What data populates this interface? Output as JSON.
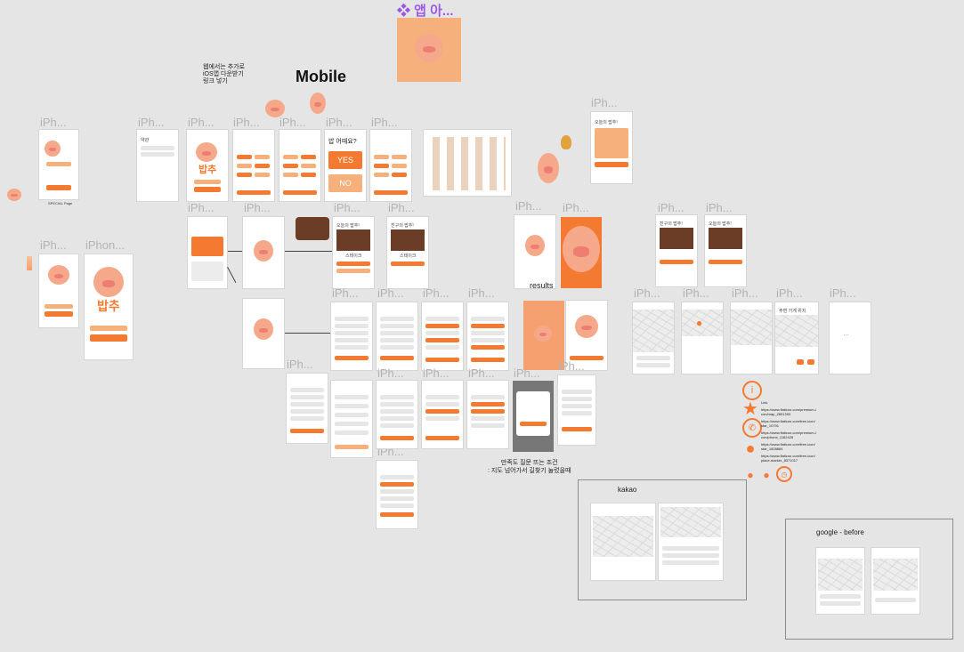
{
  "header": {
    "component_title": "❖ 앱 아...",
    "mobile": "Mobile",
    "note_ios": "웹에서는 추가로\niOS앱 다운받기\n링크 넣기"
  },
  "labels": {
    "iph": "iPh...",
    "iphon": "iPhon...",
    "results": "results",
    "kakao": "kakao",
    "google_before": "google - before",
    "survey_note": "만족도 질문 뜨는 조건\n: 지도 넘어가서 길찾기 눌렀을때",
    "special_page": "SPECIAL Page"
  },
  "screens": {
    "yes": "YES",
    "no": "NO",
    "question": "밥 어때요?",
    "todays_menu": "오늘의 밥추!",
    "friend_menu": "친구의 밥추!",
    "dish": "스테이크",
    "brand": "밥추",
    "map_title": "주변 가게 위치"
  },
  "links": [
    "https://www.flaticon.com/premium-icon/map_2891393",
    "https://www.flaticon.com/free-icon/star_10701",
    "https://www.flaticon.com/premium-icon/phone_1182428",
    "https://www.flaticon.com/free-icon/star_1828884",
    "https://www.flaticon.com/free-icon/place-marker_8371017"
  ],
  "link_head": "Link",
  "colors": {
    "accent": "#f47a32",
    "accent_light": "#f6b07b",
    "canvas": "#e5e5e5",
    "label": "#b3b3b3"
  }
}
